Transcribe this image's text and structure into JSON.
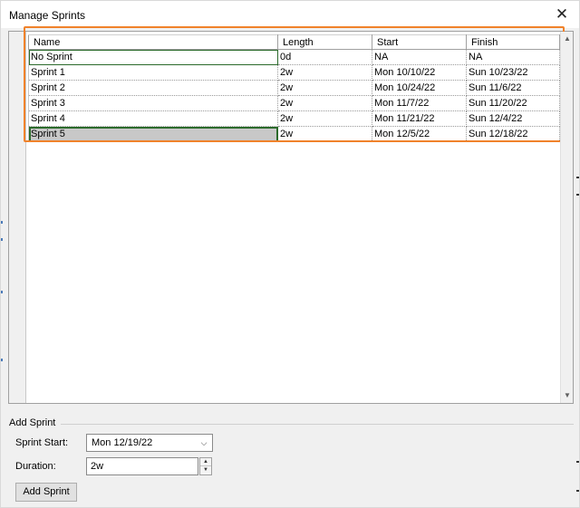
{
  "window": {
    "title": "Manage Sprints",
    "close_glyph": "✕"
  },
  "table": {
    "columns": [
      "Name",
      "Length",
      "Start",
      "Finish"
    ],
    "rows": [
      {
        "name": "No Sprint",
        "length": "0d",
        "start": "NA",
        "finish": "NA"
      },
      {
        "name": "Sprint 1",
        "length": "2w",
        "start": "Mon 10/10/22",
        "finish": "Sun 10/23/22"
      },
      {
        "name": "Sprint 2",
        "length": "2w",
        "start": "Mon 10/24/22",
        "finish": "Sun 11/6/22"
      },
      {
        "name": "Sprint 3",
        "length": "2w",
        "start": "Mon 11/7/22",
        "finish": "Sun 11/20/22"
      },
      {
        "name": "Sprint 4",
        "length": "2w",
        "start": "Mon 11/21/22",
        "finish": "Sun 12/4/22"
      },
      {
        "name": "Sprint 5",
        "length": "2w",
        "start": "Mon 12/5/22",
        "finish": "Sun 12/18/22"
      }
    ],
    "selected_row": 5,
    "highlight_color": "#f0822b"
  },
  "add_sprint": {
    "section_label": "Add Sprint",
    "start_label": "Sprint Start:",
    "start_value": "Mon 12/19/22",
    "duration_label": "Duration:",
    "duration_value": "2w",
    "button_label": "Add Sprint"
  },
  "icons": {
    "combo_caret": "chevron-down-icon",
    "spin_up": "triangle-up-icon",
    "spin_down": "triangle-down-icon",
    "scroll_up": "scroll-up-arrow-icon",
    "scroll_down": "scroll-down-arrow-icon"
  }
}
